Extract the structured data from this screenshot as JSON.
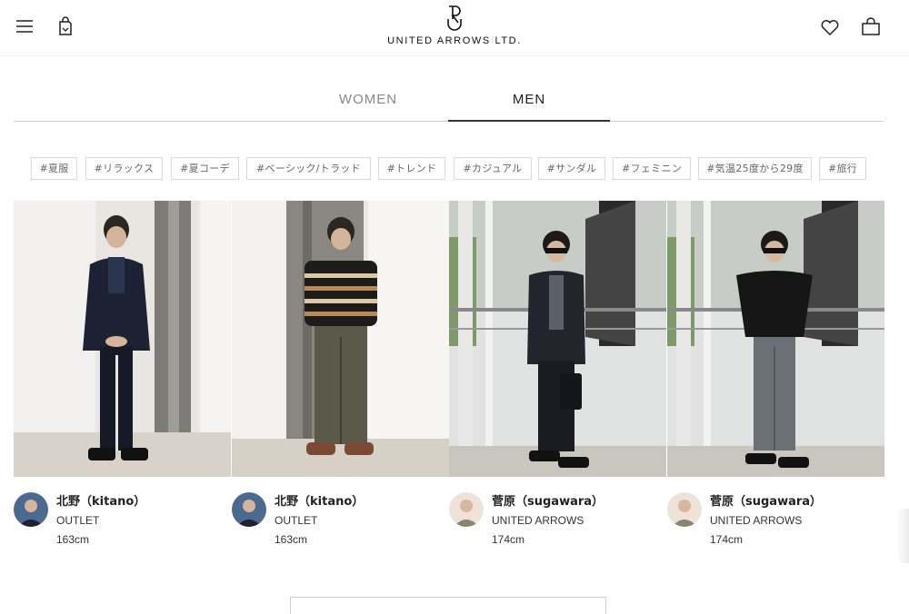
{
  "header": {
    "logo_text": "UNITED ARROWS LTD.",
    "icons": [
      "menu-icon",
      "bag-history-icon",
      "heart-icon",
      "cart-icon"
    ]
  },
  "tabs": [
    {
      "label": "WOMEN",
      "active": false
    },
    {
      "label": "MEN",
      "active": true
    }
  ],
  "hashtags": [
    "#夏服",
    "#リラックス",
    "#夏コーデ",
    "#ベーシック/トラッド",
    "#トレンド",
    "#カジュアル",
    "#サンダル",
    "#フェミニン",
    "#気温25度から29度",
    "#旅行"
  ],
  "staff": [
    {
      "name": "北野（kitano）",
      "shop": "OUTLET",
      "height": "163cm"
    },
    {
      "name": "北野（kitano）",
      "shop": "OUTLET",
      "height": "163cm"
    },
    {
      "name": "菅原（sugawara）",
      "shop": "UNITED ARROWS",
      "height": "174cm"
    },
    {
      "name": "菅原（sugawara）",
      "shop": "UNITED ARROWS",
      "height": "174cm"
    }
  ],
  "colors": {
    "text": "#222222",
    "muted": "#888888",
    "border": "#d9d9d9"
  }
}
